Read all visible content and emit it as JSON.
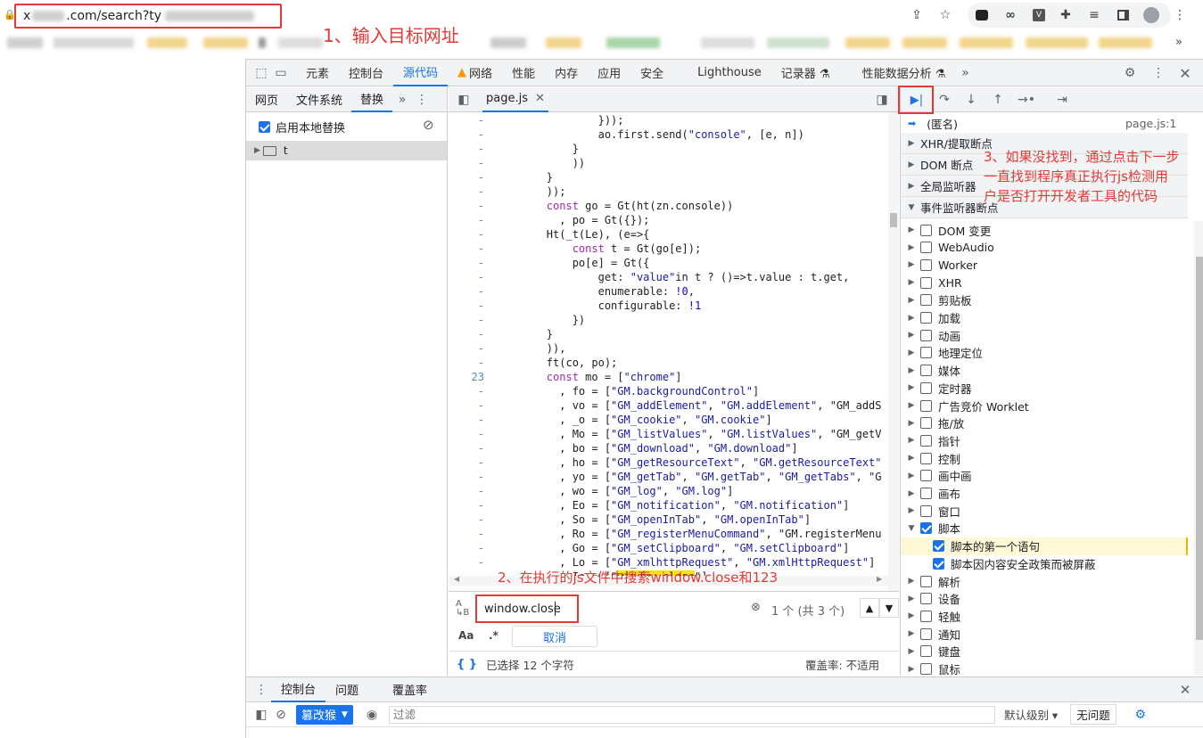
{
  "browser": {
    "url_prefix": "x",
    "url_middle": ".com/search?ty",
    "annotation_1": "1、输入目标网址",
    "ext_icons": [
      "share-icon",
      "star-icon",
      "extension-1-icon",
      "extension-2-icon",
      "extension-3-icon",
      "puzzle-icon",
      "media-icon",
      "sidepanel-icon",
      "profile-icon",
      "more-icon"
    ]
  },
  "devtools": {
    "main_tabs": [
      "元素",
      "控制台",
      "源代码",
      "网络",
      "性能",
      "内存",
      "应用",
      "安全",
      "Lighthouse",
      "记录器 ⚗",
      "性能数据分析 ⚗"
    ],
    "active_tab": "源代码",
    "navigator": {
      "tabs": [
        "网页",
        "文件系统",
        "替换"
      ],
      "active_tab": "替换",
      "enable_overrides_label": "启用本地替换",
      "folder_name": "t"
    },
    "editor": {
      "file_tab": "page.js",
      "code_lines": [
        {
          "g": "-",
          "t": "                }));"
        },
        {
          "g": "-",
          "t": "                ao.first.send(\"console\", [e, n])"
        },
        {
          "g": "-",
          "t": "            }"
        },
        {
          "g": "-",
          "t": "            ))"
        },
        {
          "g": "-",
          "t": "        }"
        },
        {
          "g": "-",
          "t": "        ));"
        },
        {
          "g": "-",
          "t": "        const go = Gt(ht(zn.console))"
        },
        {
          "g": "-",
          "t": "          , po = Gt({});"
        },
        {
          "g": "-",
          "t": "        Ht(_t(Le), (e=>{"
        },
        {
          "g": "-",
          "t": "            const t = Gt(go[e]);"
        },
        {
          "g": "-",
          "t": "            po[e] = Gt({"
        },
        {
          "g": "-",
          "t": "                get: \"value\"in t ? ()=>t.value : t.get,"
        },
        {
          "g": "-",
          "t": "                enumerable: !0,"
        },
        {
          "g": "-",
          "t": "                configurable: !1"
        },
        {
          "g": "-",
          "t": "            })"
        },
        {
          "g": "-",
          "t": "        }"
        },
        {
          "g": "-",
          "t": "        )),"
        },
        {
          "g": "-",
          "t": "        ft(co, po);"
        },
        {
          "g": "23",
          "t": "        const mo = [\"chrome\"]"
        },
        {
          "g": "-",
          "t": "          , fo = [\"GM.backgroundControl\"]"
        },
        {
          "g": "-",
          "t": "          , vo = [\"GM_addElement\", \"GM.addElement\", \"GM_addS"
        },
        {
          "g": "-",
          "t": "          , _o = [\"GM_cookie\", \"GM.cookie\"]"
        },
        {
          "g": "-",
          "t": "          , Mo = [\"GM_listValues\", \"GM.listValues\", \"GM_getV"
        },
        {
          "g": "-",
          "t": "          , bo = [\"GM_download\", \"GM.download\"]"
        },
        {
          "g": "-",
          "t": "          , ho = [\"GM_getResourceText\", \"GM.getResourceText\""
        },
        {
          "g": "-",
          "t": "          , yo = [\"GM_getTab\", \"GM.getTab\", \"GM_getTabs\", \"G"
        },
        {
          "g": "-",
          "t": "          , wo = [\"GM_log\", \"GM.log\"]"
        },
        {
          "g": "-",
          "t": "          , Eo = [\"GM_notification\", \"GM.notification\"]"
        },
        {
          "g": "-",
          "t": "          , So = [\"GM_openInTab\", \"GM.openInTab\"]"
        },
        {
          "g": "-",
          "t": "          , Ro = [\"GM_registerMenuCommand\", \"GM.registerMenu"
        },
        {
          "g": "-",
          "t": "          , Go = [\"GM_setClipboard\", \"GM.setClipboard\"]"
        },
        {
          "g": "-",
          "t": "          , Lo = [\"GM_xmlhttpRequest\", \"GM.xmlHttpRequest\"]"
        },
        {
          "g": "-",
          "t": "          , Io = [\"window.close\"]"
        }
      ],
      "annotation_2": "2、在执行的js文件中搜索window.close和123"
    },
    "search": {
      "value": "window.close",
      "count": "1 个 (共 3 个)",
      "case_label": "Aa",
      "regex_label": ".*",
      "cancel_label": "取消",
      "status": "已选择 12 个字符",
      "coverage": "覆盖率: 不适用"
    },
    "sidebar": {
      "callstack_frame": "(匿名)",
      "callstack_loc": "page.js:1",
      "sections": [
        "XHR/提取断点",
        "DOM 断点",
        "全局监听器",
        "事件监听器断点"
      ],
      "annotation_3": [
        "3、如果没找到，通过点击下一步",
        "一直找到程序真正执行js检测用",
        "户是否打开开发者工具的代码"
      ],
      "event_categories": [
        {
          "label": "DOM 变更",
          "checked": false
        },
        {
          "label": "WebAudio",
          "checked": false
        },
        {
          "label": "Worker",
          "checked": false
        },
        {
          "label": "XHR",
          "checked": false
        },
        {
          "label": "剪贴板",
          "checked": false
        },
        {
          "label": "加载",
          "checked": false
        },
        {
          "label": "动画",
          "checked": false
        },
        {
          "label": "地理定位",
          "checked": false
        },
        {
          "label": "媒体",
          "checked": false
        },
        {
          "label": "定时器",
          "checked": false
        },
        {
          "label": "广告竞价 Worklet",
          "checked": false
        },
        {
          "label": "拖/放",
          "checked": false
        },
        {
          "label": "指针",
          "checked": false
        },
        {
          "label": "控制",
          "checked": false
        },
        {
          "label": "画中画",
          "checked": false
        },
        {
          "label": "画布",
          "checked": false
        },
        {
          "label": "窗口",
          "checked": false
        },
        {
          "label": "脚本",
          "checked": true,
          "expanded": true
        }
      ],
      "script_children": [
        {
          "label": "脚本的第一个语句",
          "checked": true
        },
        {
          "label": "脚本因内容安全政策而被屏蔽",
          "checked": true
        }
      ],
      "after_categories": [
        "解析",
        "设备",
        "轻触",
        "通知",
        "键盘",
        "鼠标"
      ]
    },
    "drawer": {
      "tabs": [
        "控制台",
        "问题",
        "覆盖率"
      ],
      "active_tab": "控制台",
      "context": "篡改猴",
      "filter_placeholder": "过滤",
      "levels": "默认级别",
      "issues": "无问题"
    }
  }
}
